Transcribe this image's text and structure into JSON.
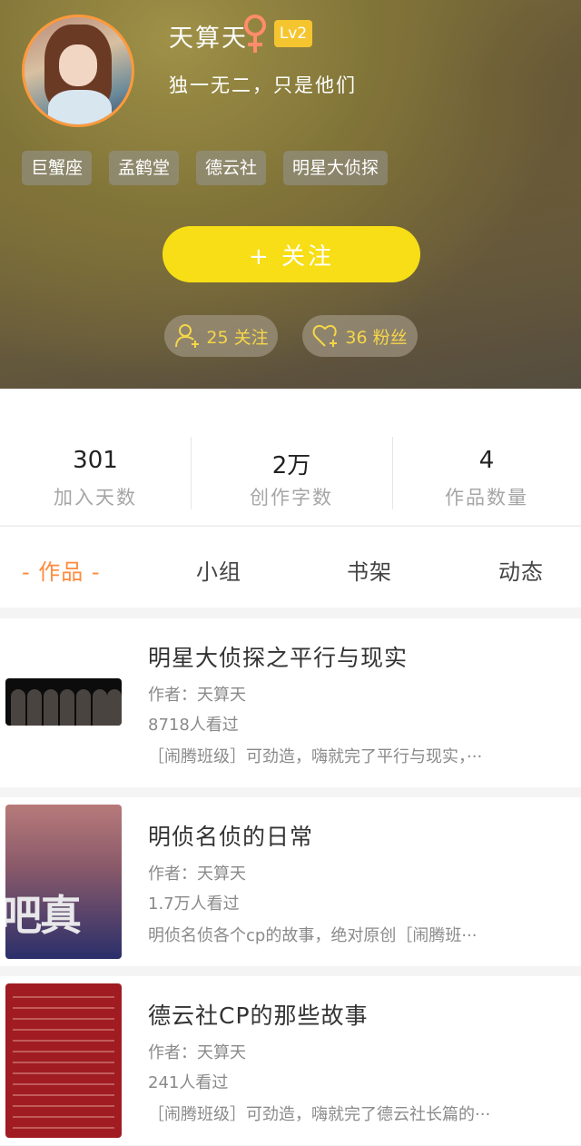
{
  "profile": {
    "username": "天算天",
    "level": "Lv2",
    "bio": "独一无二，只是他们",
    "tags": [
      "巨蟹座",
      "孟鹤堂",
      "德云社",
      "明星大侦探"
    ],
    "follow_button": "+ 关注",
    "following": "25 关注",
    "fans": "36 粉丝"
  },
  "stats": [
    {
      "value": "301",
      "label": "加入天数"
    },
    {
      "value": "2万",
      "label": "创作字数"
    },
    {
      "value": "4",
      "label": "作品数量"
    }
  ],
  "tabs": [
    "- 作品 -",
    "小组",
    "书架",
    "动态"
  ],
  "works": [
    {
      "title": "明星大侦探之平行与现实",
      "author": "作者：天算天",
      "views": "8718人看过",
      "desc": "［闹腾班级］可劲造，嗨就完了平行与现实，···"
    },
    {
      "title": "明侦名侦的日常",
      "author": "作者：天算天",
      "views": "1.7万人看过",
      "desc": "明侦名侦各个cp的故事，绝对原创［闹腾班···"
    },
    {
      "title": "德云社CP的那些故事",
      "author": "作者：天算天",
      "views": "241人看过",
      "desc": "［闹腾班级］可劲造，嗨就完了德云社长篇的···"
    }
  ],
  "thumb2_text": "吧真",
  "colors": {
    "accent": "#ff8a3c",
    "follow_button": "#f7de16",
    "level_badge": "#f5c530",
    "pill_text": "#f6d648"
  }
}
